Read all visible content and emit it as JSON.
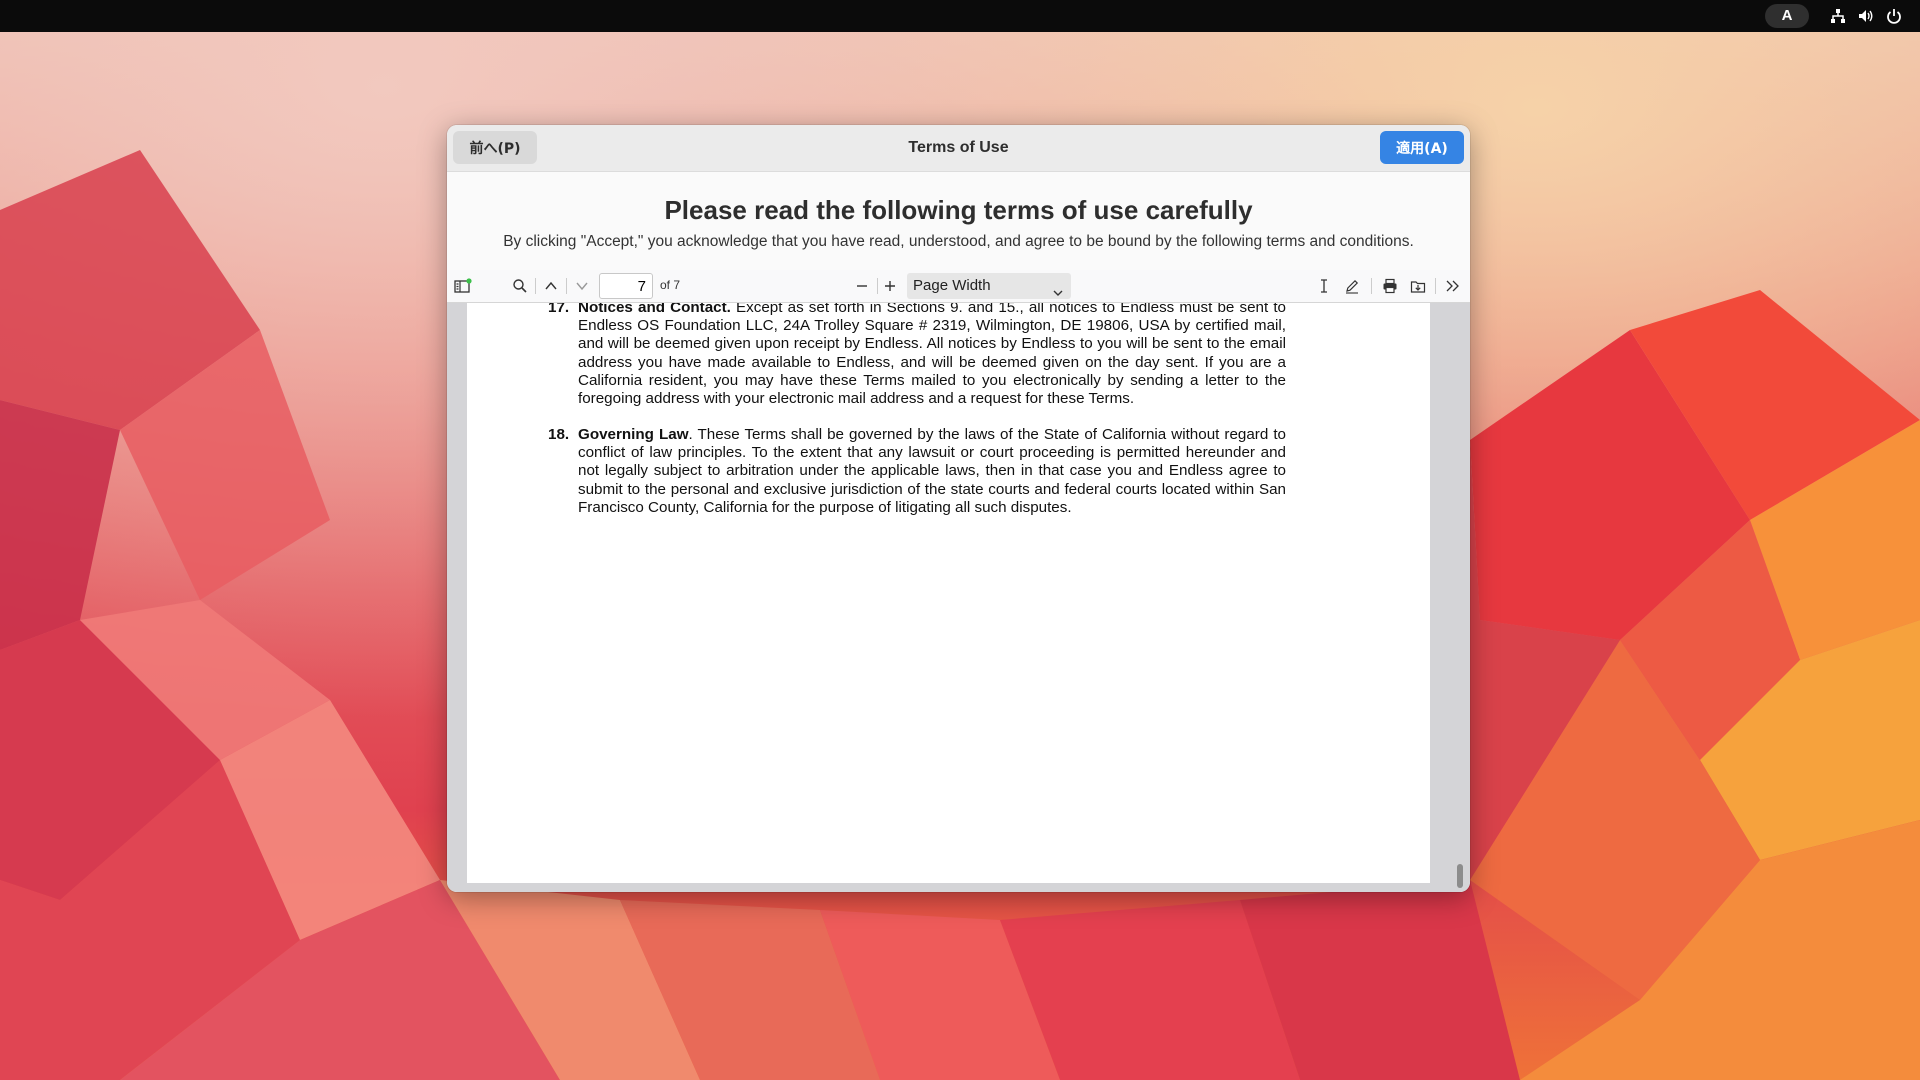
{
  "topbar": {
    "keyboard_indicator": "A",
    "tray_icons": [
      "network-icon",
      "volume-icon",
      "power-icon"
    ]
  },
  "dialog": {
    "title": "Terms of Use",
    "prev_button": "前へ(P)",
    "apply_button": "適用(A)",
    "accent_color": "#3584e4"
  },
  "content": {
    "heading": "Please read the following terms of use carefully",
    "subheading": "By clicking \"Accept,\" you acknowledge that you have read, understood, and agree to be bound by the following terms and conditions."
  },
  "pdf": {
    "current_page": "7",
    "page_count_label": "of 7",
    "zoom_label": "Page Width",
    "clauses": [
      {
        "number": "17.",
        "title": "Notices and Contact.",
        "text": " Except as set forth in Sections 9. and 15., all notices to Endless must be sent to Endless OS Foundation LLC, 24A Trolley Square # 2319, Wilmington, DE 19806, USA by certified mail, and will be deemed given upon receipt by Endless.  All notices by Endless to you will be sent to the email address you have made available to Endless, and will be deemed given on the day sent. If you are a California resident, you may have these Terms mailed to you electronically by sending a letter to the foregoing address with your electronic mail address and a request for these Terms."
      },
      {
        "number": "18.",
        "title": "Governing Law",
        "text": ". These Terms shall be governed by the laws of the State of California without regard to conflict of law principles. To the extent that any lawsuit or court proceeding is permitted hereunder and not legally subject to arbitration under the applicable laws, then in that case you and Endless agree to submit to the personal and exclusive jurisdiction of the state courts and federal courts located within San Francisco County, California for the purpose of litigating all such disputes."
      }
    ]
  }
}
